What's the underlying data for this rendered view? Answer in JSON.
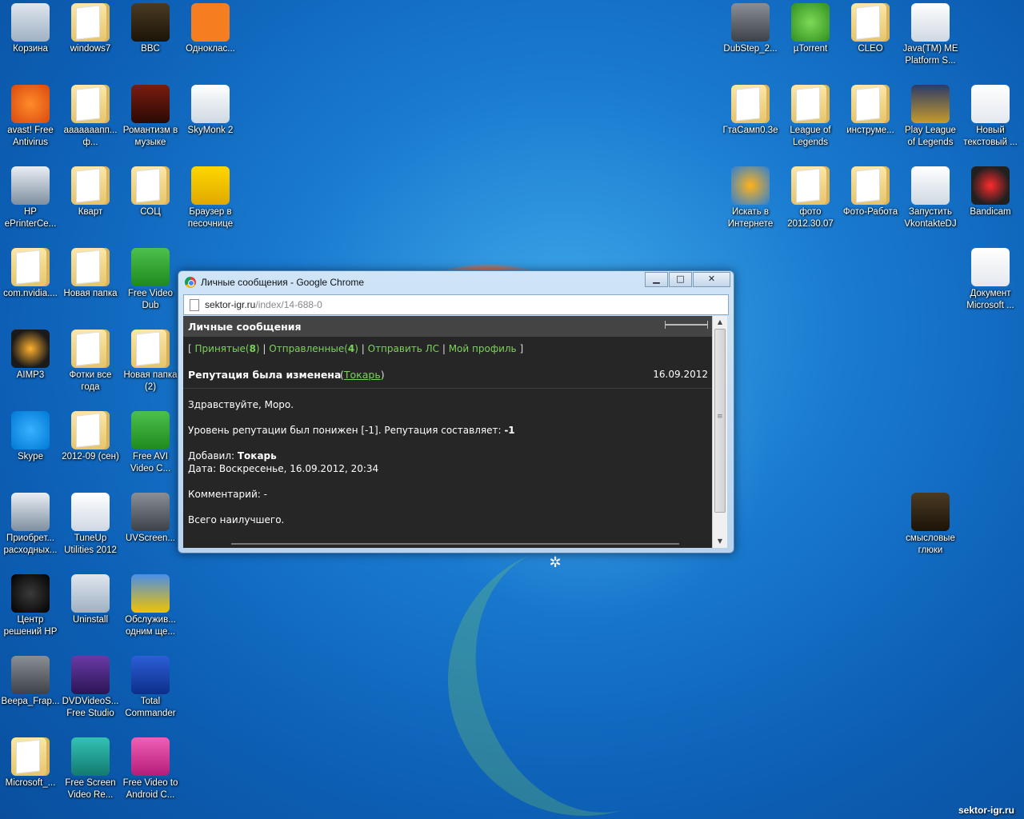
{
  "desktop": {
    "left_icons": [
      {
        "label": "Корзина",
        "icon": "recycle-bin-icon",
        "style": "bin"
      },
      {
        "label": "windows7",
        "icon": "folder-icon",
        "style": "folder"
      },
      {
        "label": "BBC",
        "icon": "folder-icon",
        "style": "dark-folder"
      },
      {
        "label": "Одноклас...",
        "icon": "odnoklassniki-icon",
        "style": "orange"
      },
      {
        "label": "avast! Free Antivirus",
        "icon": "avast-icon",
        "style": "orange2"
      },
      {
        "label": "ааааааапп... ф...",
        "icon": "folder-icon",
        "style": "folder"
      },
      {
        "label": "Романтизм в музыке",
        "icon": "video-thumb-icon",
        "style": "dark"
      },
      {
        "label": "SkyMonk 2",
        "icon": "skymonk-icon",
        "style": "white"
      },
      {
        "label": "HP ePrinterCe...",
        "icon": "printer-icon",
        "style": "printer"
      },
      {
        "label": "Кварт",
        "icon": "folder-icon",
        "style": "folder"
      },
      {
        "label": "СОЦ",
        "icon": "folder-icon",
        "style": "folder"
      },
      {
        "label": "Браузер в песочнице",
        "icon": "sandbox-browser-icon",
        "style": "yellow"
      },
      {
        "label": "com.nvidia....",
        "icon": "folder-icon",
        "style": "folder"
      },
      {
        "label": "Новая папка",
        "icon": "folder-icon",
        "style": "folder"
      },
      {
        "label": "Free Video Dub",
        "icon": "scissors-icon",
        "style": "green"
      },
      {
        "label": "AIMP3",
        "icon": "aimp-icon",
        "style": "aimp"
      },
      {
        "label": "Фотки все года",
        "icon": "folder-icon",
        "style": "folder"
      },
      {
        "label": "Новая папка (2)",
        "icon": "folder-icon",
        "style": "folder"
      },
      {
        "label": "Skype",
        "icon": "skype-icon",
        "style": "skype"
      },
      {
        "label": "2012-09 (сен)",
        "icon": "folder-icon",
        "style": "folder"
      },
      {
        "label": "Free AVI Video C...",
        "icon": "avi-icon",
        "style": "green"
      },
      {
        "label": "Приобрет... расходных...",
        "icon": "printer-supplies-icon",
        "style": "printer"
      },
      {
        "label": "TuneUp Utilities 2012",
        "icon": "tuneup-icon",
        "style": "white"
      },
      {
        "label": "UVScreen...",
        "icon": "camera-icon",
        "style": "gray"
      },
      {
        "label": "Центр решений HP",
        "icon": "hp-icon",
        "style": "hp"
      },
      {
        "label": "Uninstall",
        "icon": "uninstall-icon",
        "style": "bin"
      },
      {
        "label": "Обслужив... одним ще...",
        "icon": "shield-icon",
        "style": "shield"
      },
      {
        "label": "Beepa_Frap...",
        "icon": "film-icon",
        "style": "gray"
      },
      {
        "label": "DVDVideoS... Free Studio",
        "icon": "fs-icon",
        "style": "purple"
      },
      {
        "label": "Total Commander",
        "icon": "floppy-icon",
        "style": "floppy"
      },
      {
        "label": "Microsoft_...",
        "icon": "folder-icon",
        "style": "folder"
      },
      {
        "label": "Free Screen Video Re...",
        "icon": "screen-rec-icon",
        "style": "teal"
      },
      {
        "label": "Free Video to Android C...",
        "icon": "android-icon",
        "style": "pink"
      }
    ],
    "right_icons": [
      {
        "label": "DubStep_2...",
        "icon": "music-icon",
        "style": "gray"
      },
      {
        "label": "µTorrent",
        "icon": "utorrent-icon",
        "style": "utorrent"
      },
      {
        "label": "CLEO",
        "icon": "folder-icon",
        "style": "folder"
      },
      {
        "label": "Java(TM) ME Platform S...",
        "icon": "phone-icon",
        "style": "white"
      },
      {
        "label": "ГтаСамп0.3е",
        "icon": "folder-icon",
        "style": "folder"
      },
      {
        "label": "League of Legends",
        "icon": "folder-icon",
        "style": "folder"
      },
      {
        "label": "инструме...",
        "icon": "folder-icon",
        "style": "folder"
      },
      {
        "label": "Play League of Legends",
        "icon": "lol-icon",
        "style": "lol"
      },
      {
        "label": "Новый текстовый ...",
        "icon": "text-file-icon",
        "style": "doc"
      },
      {
        "label": "Искать в Интернете",
        "icon": "search-web-icon",
        "style": "search"
      },
      {
        "label": "фото 2012.30.07",
        "icon": "folder-icon",
        "style": "folder"
      },
      {
        "label": "Фото-Работа",
        "icon": "folder-icon",
        "style": "folder"
      },
      {
        "label": "Запустить VkontakteDJ",
        "icon": "vkdj-icon",
        "style": "white"
      },
      {
        "label": "Bandicam",
        "icon": "bandicam-icon",
        "style": "bandicam"
      },
      {
        "label": "Документ Microsoft ...",
        "icon": "word-doc-icon",
        "style": "doc"
      },
      {
        "label": "смысловые глюки",
        "icon": "folder-icon",
        "style": "dark-folder"
      }
    ]
  },
  "window": {
    "title": "Личные сообщения - Google Chrome",
    "minimize": "▁",
    "maximize": "□",
    "close": "✕",
    "url_domain": "sektor-igr.ru",
    "url_path": "/index/14-688-0"
  },
  "page": {
    "header": "Личные сообщения",
    "nav": {
      "open": "[",
      "inbox": "Принятые",
      "inbox_count": "8",
      "sent": "Отправленные",
      "sent_count": "4",
      "send": "Отправить ЛС",
      "profile": "Мой профиль",
      "close": "]"
    },
    "message": {
      "subject": "Репутация была изменена",
      "from": "Токарь",
      "date": "16.09.2012",
      "greeting": "Здравствуйте, Моро.",
      "line1_prefix": "Уровень репутации был понижен [-1]. Репутация составляет: ",
      "line1_value": "-1",
      "added_by_label": "Добавил: ",
      "added_by": "Токарь",
      "date_line": "Дата: Воскресенье, 16.09.2012, 20:34",
      "comment": "Комментарий: -",
      "signoff": "Всего наилучшего."
    }
  },
  "watermark": "sektor-igr.ru",
  "colors": {
    "link_green": "#7bd35a",
    "content_bg": "#262626",
    "desktop_blue": "#1a7bd0"
  }
}
